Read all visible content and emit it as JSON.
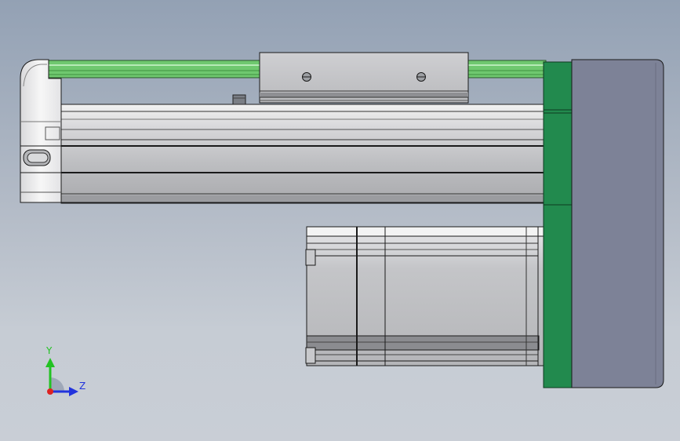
{
  "viewport": {
    "background_top": "#93a1b4",
    "background_bottom": "#c9ced6"
  },
  "colors": {
    "rail_green": "#6fc86f",
    "flange_green": "#228a4e",
    "motor_housing": "#7d8297",
    "body_gray": "#bcbdc0",
    "edge_line": "#1a1a1a"
  },
  "triad": {
    "y_label": "Y",
    "z_label": "Z",
    "y_color": "#22c222",
    "z_color": "#2233dd",
    "origin_color": "#dd2222"
  }
}
